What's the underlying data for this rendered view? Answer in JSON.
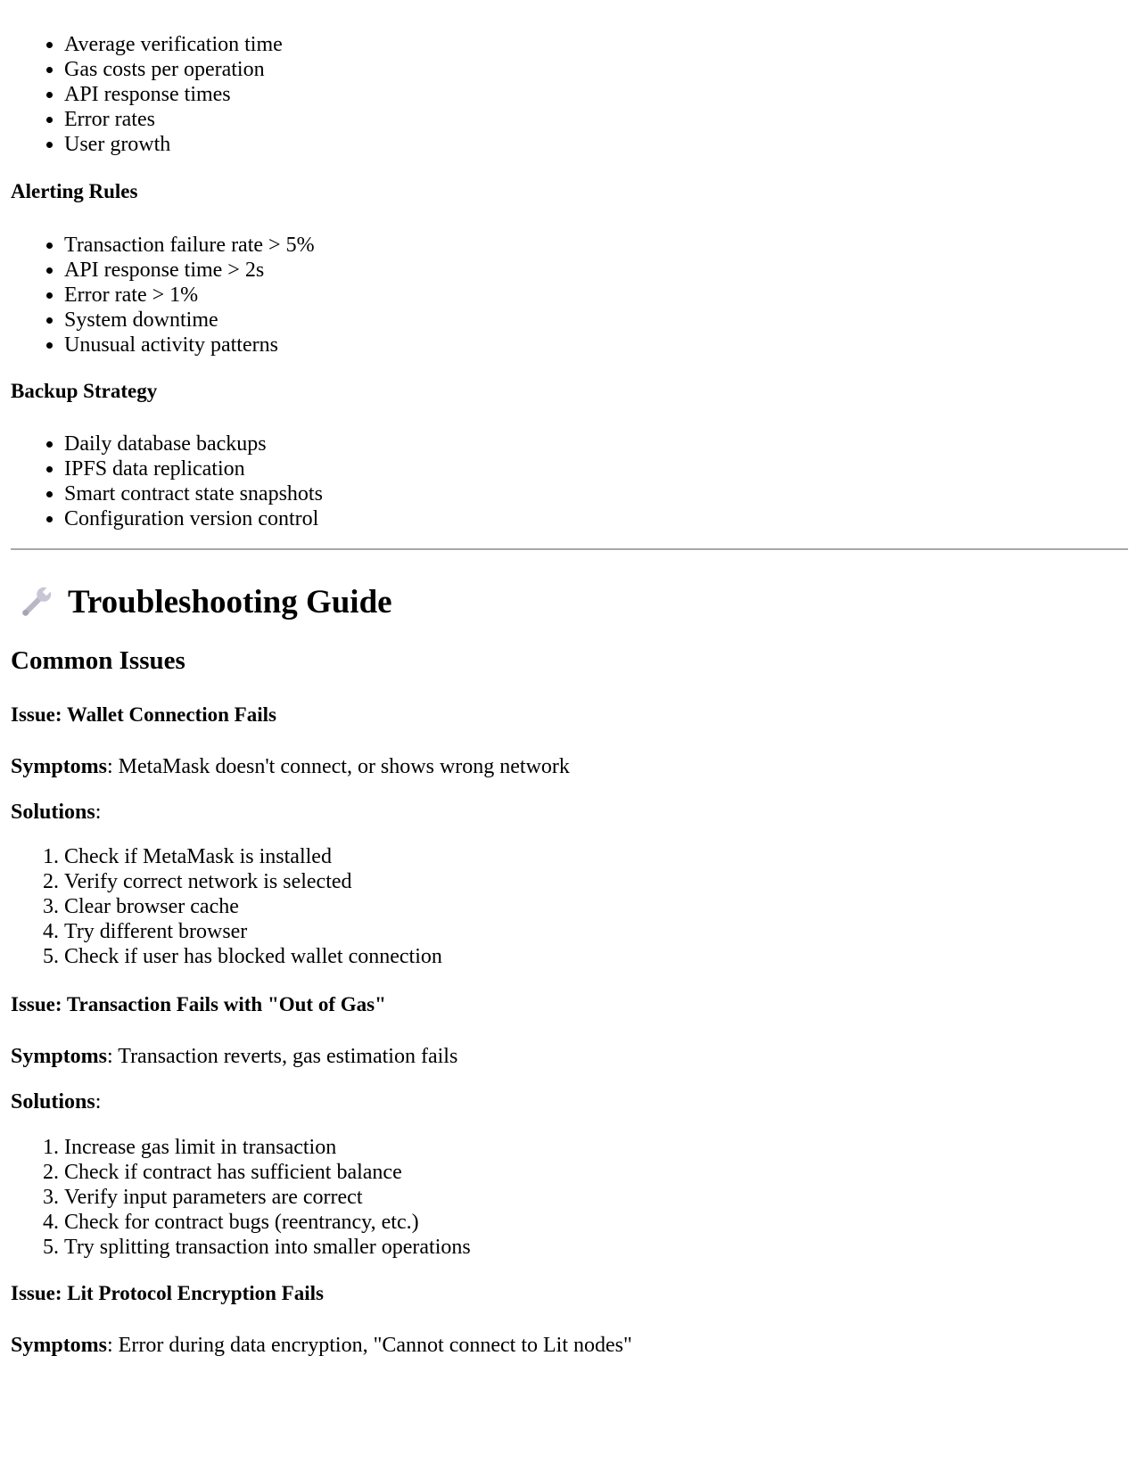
{
  "metrics_list": [
    "Average verification time",
    "Gas costs per operation",
    "API response times",
    "Error rates",
    "User growth"
  ],
  "alerting": {
    "heading": "Alerting Rules",
    "items": [
      "Transaction failure rate > 5%",
      "API response time > 2s",
      "Error rate > 1%",
      "System downtime",
      "Unusual activity patterns"
    ]
  },
  "backup": {
    "heading": "Backup Strategy",
    "items": [
      "Daily database backups",
      "IPFS data replication",
      "Smart contract state snapshots",
      "Configuration version control"
    ]
  },
  "troubleshooting": {
    "title": "Troubleshooting Guide",
    "icon": "wrench-icon",
    "common_issues_heading": "Common Issues",
    "issues": [
      {
        "title": "Issue: Wallet Connection Fails",
        "symptoms_label": "Symptoms",
        "symptoms_text": ": MetaMask doesn't connect, or shows wrong network",
        "solutions_label": "Solutions",
        "solutions_suffix": ":",
        "solutions": [
          "Check if MetaMask is installed",
          "Verify correct network is selected",
          "Clear browser cache",
          "Try different browser",
          "Check if user has blocked wallet connection"
        ]
      },
      {
        "title": "Issue: Transaction Fails with \"Out of Gas\"",
        "symptoms_label": "Symptoms",
        "symptoms_text": ": Transaction reverts, gas estimation fails",
        "solutions_label": "Solutions",
        "solutions_suffix": ":",
        "solutions": [
          "Increase gas limit in transaction",
          "Check if contract has sufficient balance",
          "Verify input parameters are correct",
          "Check for contract bugs (reentrancy, etc.)",
          "Try splitting transaction into smaller operations"
        ]
      },
      {
        "title": "Issue: Lit Protocol Encryption Fails",
        "symptoms_label": "Symptoms",
        "symptoms_text": ": Error during data encryption, \"Cannot connect to Lit nodes\""
      }
    ]
  }
}
